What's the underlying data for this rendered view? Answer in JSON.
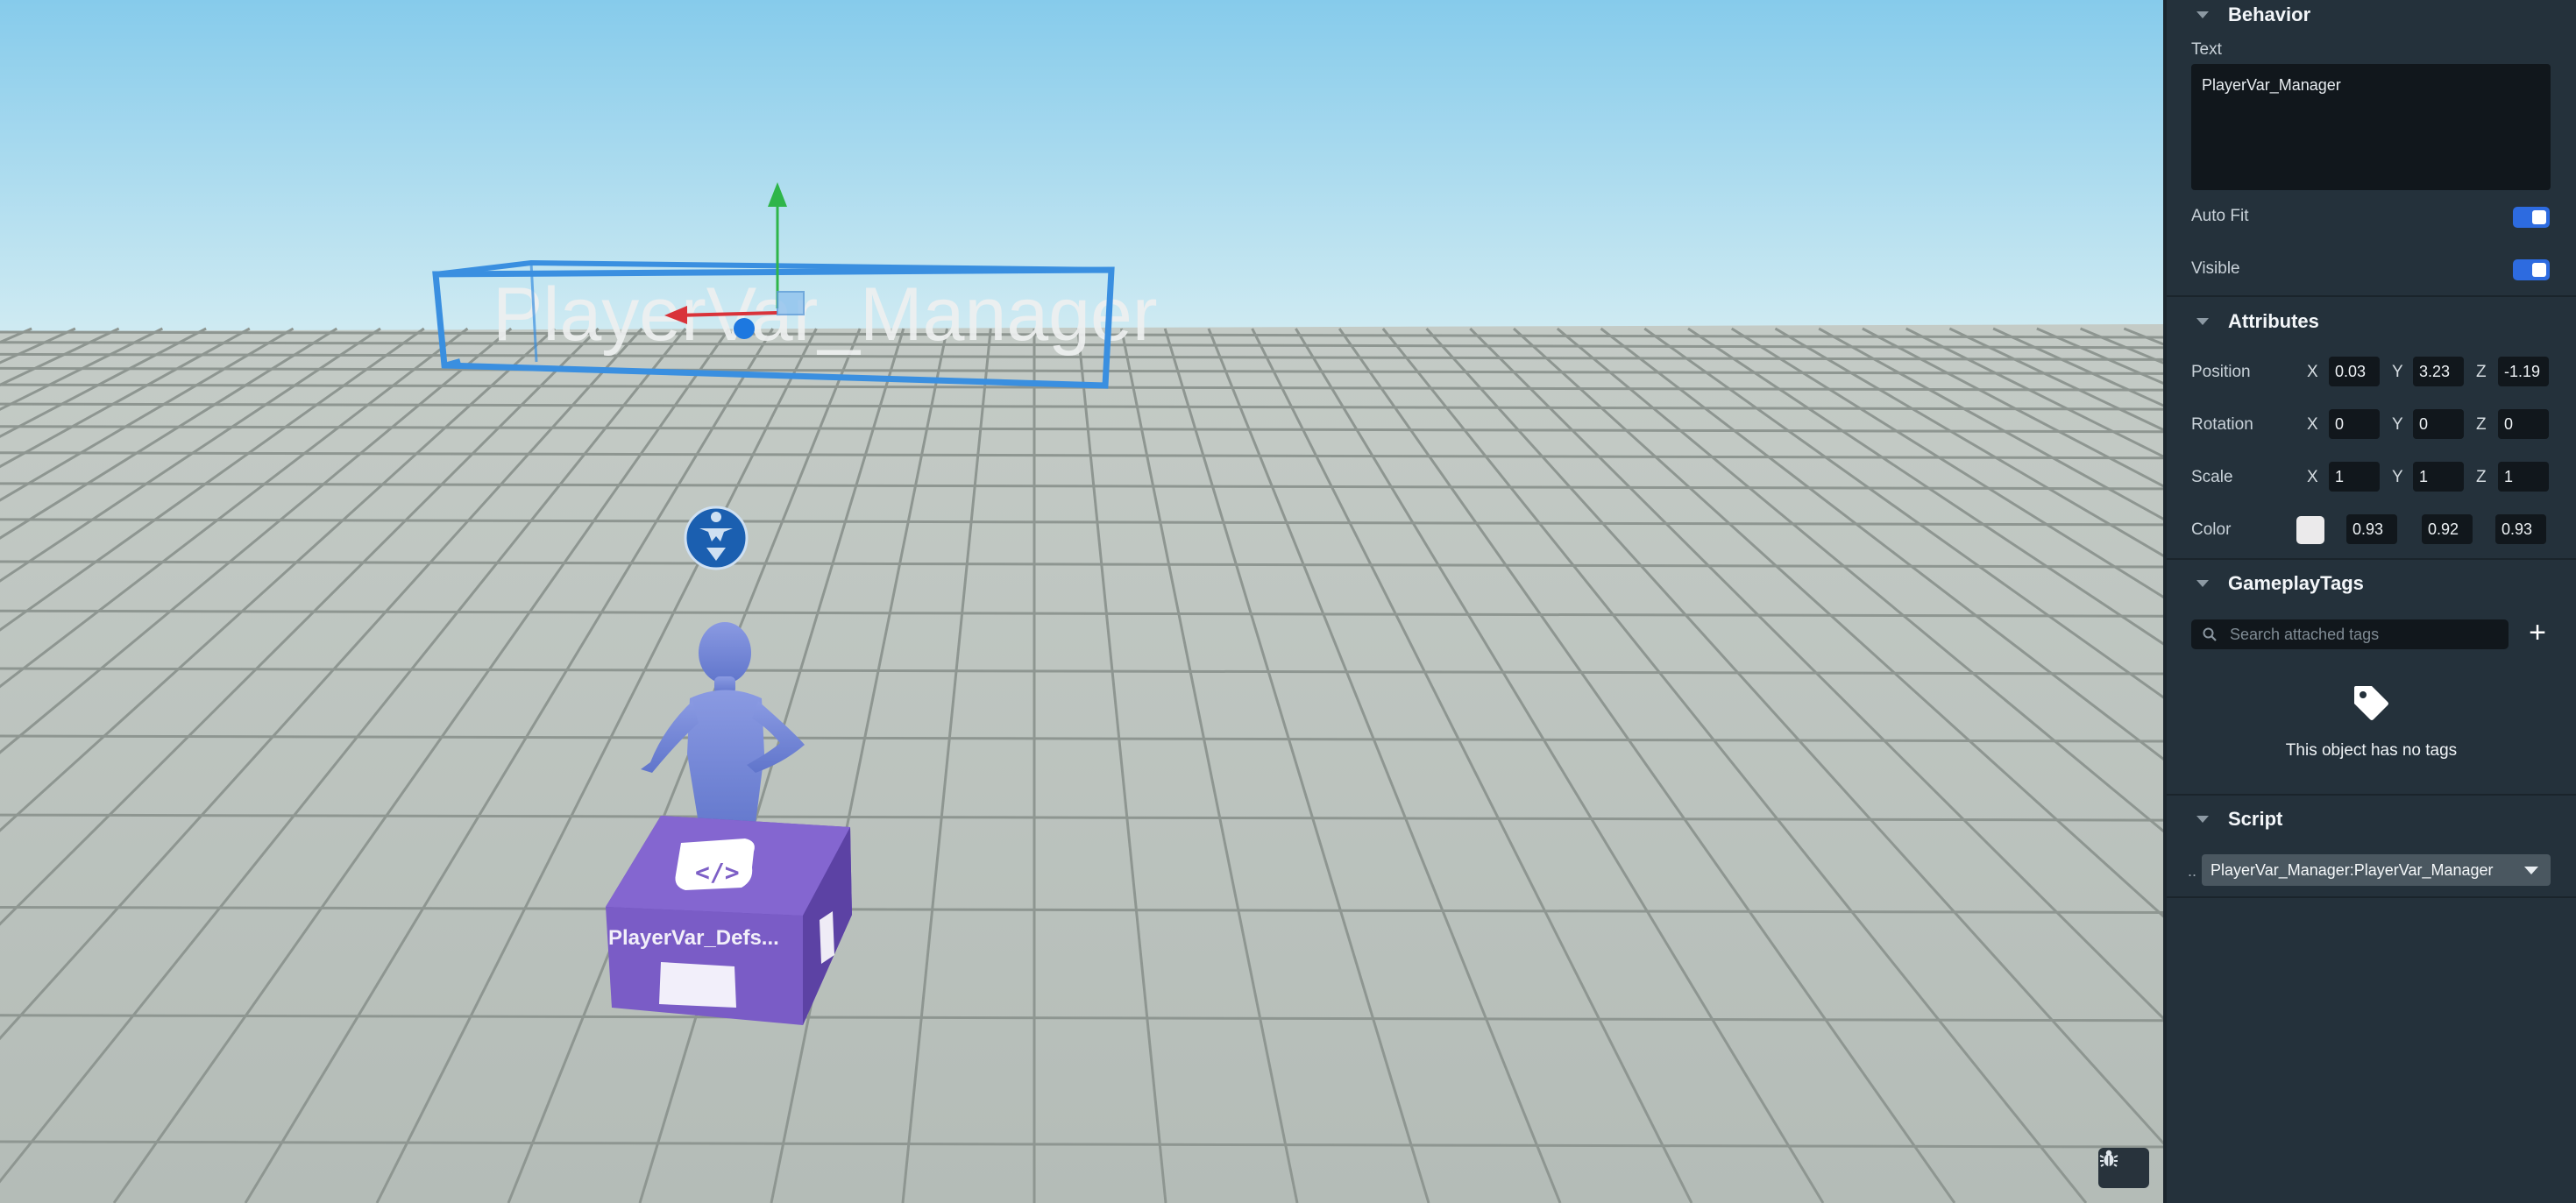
{
  "viewport": {
    "floating_label": "PlayerVar_Manager",
    "box_label": "PlayerVar_Defs...",
    "icons": [
      "gizmo-y-arrow-icon",
      "gizmo-x-arrow-icon",
      "spawn-point-icon",
      "script-icon",
      "bug-icon"
    ]
  },
  "behavior": {
    "title": "Behavior",
    "text_label": "Text",
    "text_value": "PlayerVar_Manager",
    "autofit_label": "Auto Fit",
    "autofit_on": true,
    "visible_label": "Visible",
    "visible_on": true
  },
  "attributes": {
    "title": "Attributes",
    "position": {
      "label": "Position",
      "x": "0.03",
      "y": "3.23",
      "z": "-1.19"
    },
    "rotation": {
      "label": "Rotation",
      "x": "0",
      "y": "0",
      "z": "0"
    },
    "scale": {
      "label": "Scale",
      "x": "1",
      "y": "1",
      "z": "1"
    },
    "color": {
      "label": "Color",
      "r": "0.93",
      "g": "0.92",
      "b": "0.93",
      "swatch": "#ebeaeb"
    },
    "axis_x": "X",
    "axis_y": "Y",
    "axis_z": "Z"
  },
  "gameplay_tags": {
    "title": "GameplayTags",
    "search_placeholder": "Search attached tags",
    "add_label": "+",
    "empty_message": "This object has no tags"
  },
  "script": {
    "title": "Script",
    "ellipsis": "..",
    "selected": "PlayerVar_Manager:PlayerVar_Manager"
  },
  "colors": {
    "selection": "#3a8fe0",
    "sky_top": "#86cbeb",
    "ground": "#c3c9c4",
    "accent": "#2d6be0",
    "mannequin": "#7587d8",
    "script_box": "#7d5fc6"
  }
}
